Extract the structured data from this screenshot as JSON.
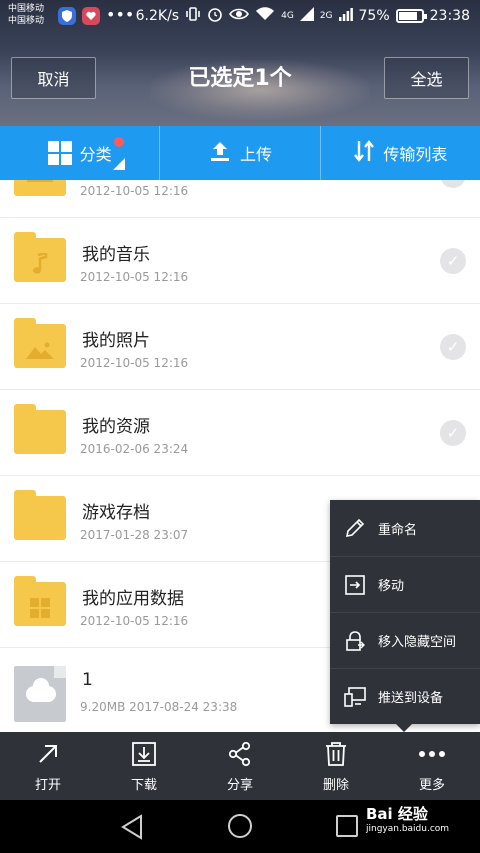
{
  "status_bar": {
    "carrier_line1": "中国移动",
    "carrier_line2": "中国移动",
    "speed": "6.2K/s",
    "network_4g": "4G",
    "network_2g": "2G",
    "battery": "75%",
    "time": "23:38"
  },
  "header": {
    "cancel_label": "取消",
    "title": "已选定1个",
    "select_all_label": "全选"
  },
  "tabs": [
    {
      "label": "分类",
      "icon": "grid-icon"
    },
    {
      "label": "上传",
      "icon": "upload-icon"
    },
    {
      "label": "传输列表",
      "icon": "transfer-icon"
    }
  ],
  "files": [
    {
      "name": "",
      "meta": "2012-10-05  12:16",
      "type": "folder",
      "selected": false
    },
    {
      "name": "我的音乐",
      "meta": "2012-10-05  12:16",
      "type": "folder-music",
      "selected": false
    },
    {
      "name": "我的照片",
      "meta": "2012-10-05  12:16",
      "type": "folder-photo",
      "selected": false
    },
    {
      "name": "我的资源",
      "meta": "2016-02-06  23:24",
      "type": "folder",
      "selected": false
    },
    {
      "name": "游戏存档",
      "meta": "2017-01-28  23:07",
      "type": "folder",
      "selected": false
    },
    {
      "name": "我的应用数据",
      "meta": "2012-10-05  12:16",
      "type": "folder-apps",
      "selected": false
    },
    {
      "name": "1",
      "meta": "9.20MB    2017-08-24  23:38",
      "type": "cloud-file",
      "selected": true
    }
  ],
  "popup_menu": [
    {
      "label": "重命名",
      "icon": "pencil-icon"
    },
    {
      "label": "移动",
      "icon": "move-icon"
    },
    {
      "label": "移入隐藏空间",
      "icon": "hidden-lock-icon"
    },
    {
      "label": "推送到设备",
      "icon": "push-device-icon"
    }
  ],
  "actions": [
    {
      "label": "打开",
      "icon": "open-arrow-icon"
    },
    {
      "label": "下载",
      "icon": "download-icon"
    },
    {
      "label": "分享",
      "icon": "share-icon"
    },
    {
      "label": "删除",
      "icon": "trash-icon"
    },
    {
      "label": "更多",
      "icon": "more-icon"
    }
  ],
  "watermark": {
    "brand": "Bai 经验",
    "url": "jingyan.baidu.com"
  },
  "colors": {
    "accent": "#1e9bf0",
    "dark_bar": "#2f3239",
    "folder": "#f5c84c",
    "checked": "#1e77d8"
  }
}
